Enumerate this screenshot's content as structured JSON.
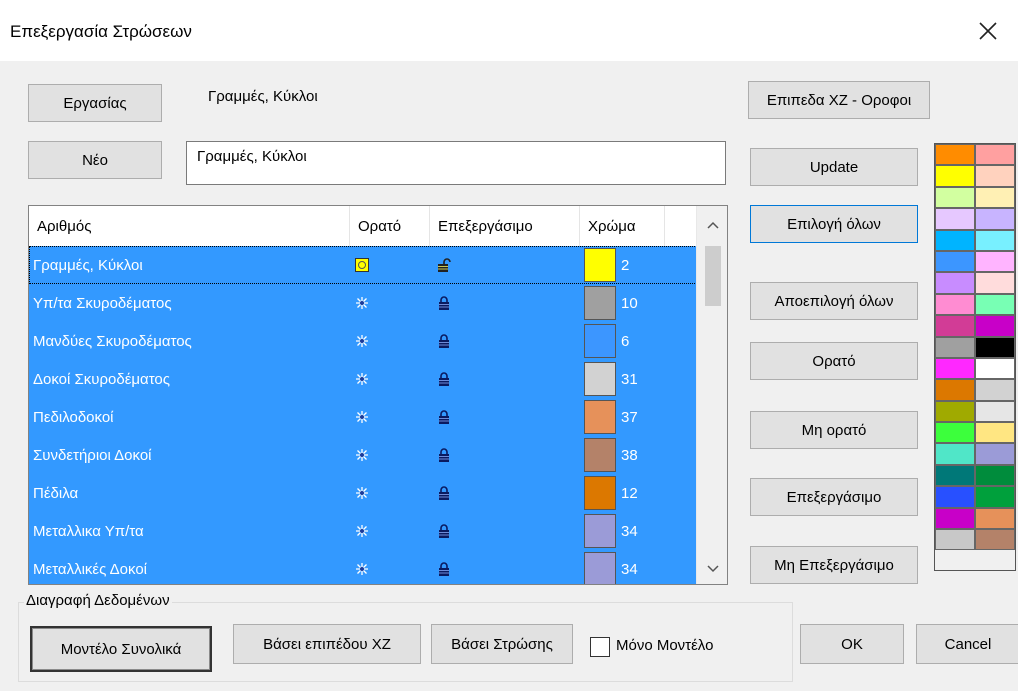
{
  "window": {
    "title": "Επεξεργασία Στρώσεων"
  },
  "top": {
    "work_button": "Εργασίας",
    "current_layer_label": "Γραμμές, Κύκλοι",
    "new_button": "Νέο",
    "name_input_value": "Γραμμές, Κύκλοι"
  },
  "list": {
    "headers": {
      "number": "Αριθμός",
      "visible": "Ορατό",
      "editable": "Επεξεργάσιμο",
      "color": "Χρώμα"
    },
    "rows": [
      {
        "name": "Γραμμές, Κύκλοι",
        "visible": "sun-icon",
        "editable": "unlock-icon",
        "color": "#ffff00",
        "num": "2"
      },
      {
        "name": "Υπ/τα Σκυροδέματος",
        "visible": "snowflake-icon",
        "editable": "lock-icon",
        "color": "#a0a0a0",
        "num": "10"
      },
      {
        "name": "Μανδύες Σκυροδέματος",
        "visible": "snowflake-icon",
        "editable": "lock-icon",
        "color": "#3c96ff",
        "num": "6"
      },
      {
        "name": "Δοκοί Σκυροδέματος",
        "visible": "snowflake-icon",
        "editable": "lock-icon",
        "color": "#d2d2d2",
        "num": "31"
      },
      {
        "name": "Πεδιλοδοκοί",
        "visible": "snowflake-icon",
        "editable": "lock-icon",
        "color": "#e6915a",
        "num": "37"
      },
      {
        "name": "Συνδετήριοι Δοκοί",
        "visible": "snowflake-icon",
        "editable": "lock-icon",
        "color": "#b48269",
        "num": "38"
      },
      {
        "name": "Πέδιλα",
        "visible": "snowflake-icon",
        "editable": "lock-icon",
        "color": "#dc7800",
        "num": "12"
      },
      {
        "name": "Μεταλλικα Υπ/τα",
        "visible": "snowflake-icon",
        "editable": "lock-icon",
        "color": "#9b9bd7",
        "num": "34"
      },
      {
        "name": "Μεταλλικές Δοκοί",
        "visible": "snowflake-icon",
        "editable": "lock-icon",
        "color": "#9b9bd7",
        "num": "34"
      }
    ]
  },
  "right": {
    "levels_button": "Επιπεδα XZ - Οροφοι",
    "update_button": "Update",
    "select_all_button": "Επιλογή όλων",
    "deselect_all_button": "Αποεπιλογή όλων",
    "visible_button": "Ορατό",
    "not_visible_button": "Μη ορατό",
    "editable_button": "Επεξεργάσιμο",
    "not_editable_button": "Μη Επεξεργάσιμο"
  },
  "palette": [
    "#ff8c00",
    "#ffa0a0",
    "#ffff00",
    "#ffd2be",
    "#d2ffa0",
    "#fff0b4",
    "#e6c8ff",
    "#c8b4ff",
    "#00b4ff",
    "#78f0ff",
    "#3c96ff",
    "#ffb4ff",
    "#c88cff",
    "#ffdcdc",
    "#ff8cd2",
    "#78ffb4",
    "#d23c96",
    "#c800c8",
    "#a0a0a0",
    "#000000",
    "#ff28ff",
    "#ffffff",
    "#dc7800",
    "#d2d2d2",
    "#a0aa00",
    "#e6e6e6",
    "#3cff3c",
    "#ffe682",
    "#50e6c8",
    "#9b9bd7",
    "#007878",
    "#008c3c",
    "#2850ff",
    "#00a03c",
    "#c800c8",
    "#e6915a",
    "#c8c8c8",
    "#b48269"
  ],
  "bottom": {
    "group_label": "Διαγραφή Δεδομένων",
    "model_total_button": "Μοντέλο Συνολικά",
    "by_level_button": "Βάσει επιπέδου XZ",
    "by_layer_button": "Βάσει Στρώσης",
    "model_only_label": "Μόνο Μοντέλο",
    "ok_button": "OK",
    "cancel_button": "Cancel"
  }
}
